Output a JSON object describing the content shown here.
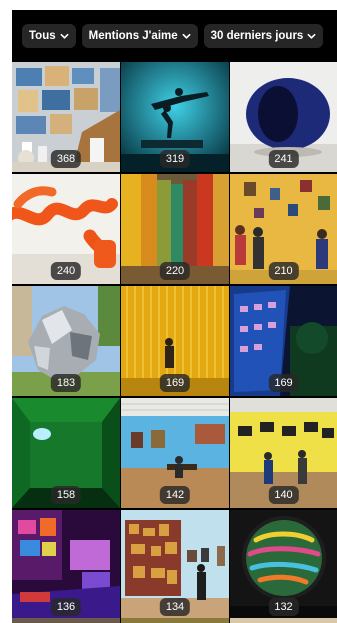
{
  "filters": {
    "type_label": "Tous",
    "metric_label": "Mentions J'aime",
    "period_label": "30 derniers jours"
  },
  "posts": [
    {
      "count": "368",
      "subject": "map-wall-gallery-photo"
    },
    {
      "count": "319",
      "subject": "acrobats-teal-stage-photo"
    },
    {
      "count": "241",
      "subject": "blue-sculpture-photo"
    },
    {
      "count": "240",
      "subject": "orange-tube-sculpture-photo"
    },
    {
      "count": "220",
      "subject": "colored-curtain-room-photo"
    },
    {
      "count": "210",
      "subject": "yellow-wall-visitors-photo"
    },
    {
      "count": "183",
      "subject": "chrome-sculpture-photo"
    },
    {
      "count": "169",
      "subject": "yellow-threads-installation-photo"
    },
    {
      "count": "169",
      "subject": "blue-building-night-photo"
    },
    {
      "count": "158",
      "subject": "green-room-photo"
    },
    {
      "count": "142",
      "subject": "blue-gallery-room-photo"
    },
    {
      "count": "140",
      "subject": "yellow-wall-screens-photo"
    },
    {
      "count": "136",
      "subject": "neon-purple-room-photo"
    },
    {
      "count": "134",
      "subject": "painting-viewer-photo"
    },
    {
      "count": "132",
      "subject": "graffiti-circle-photo"
    }
  ],
  "colors": {
    "background": "#000000",
    "chip": "#262626",
    "text": "#ffffff"
  }
}
